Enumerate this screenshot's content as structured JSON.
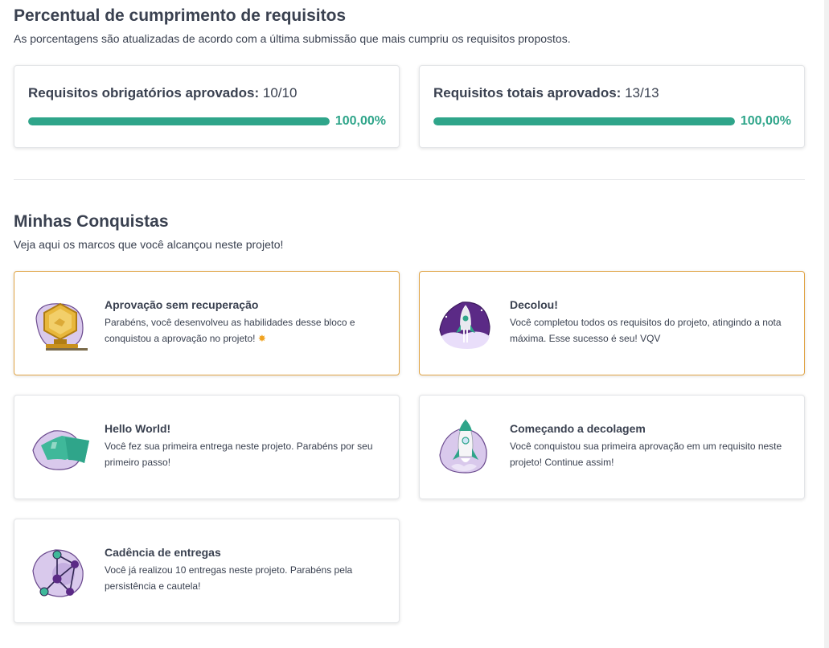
{
  "requirements": {
    "title": "Percentual de cumprimento de requisitos",
    "subtitle": "As porcentagens são atualizadas de acordo com a última submissão que mais cumpriu os requisitos propostos.",
    "cards": [
      {
        "label": "Requisitos obrigatórios aprovados:",
        "value": "10/10",
        "percent_text": "100,00%",
        "progress": 1.0
      },
      {
        "label": "Requisitos totais aprovados:",
        "value": "13/13",
        "percent_text": "100,00%",
        "progress": 1.0
      }
    ]
  },
  "achievements": {
    "title": "Minhas Conquistas",
    "subtitle": "Veja aqui os marcos que você alcançou neste projeto!",
    "items": [
      {
        "title": "Aprovação sem recuperação",
        "description": "Parabéns, você desenvolveu as habilidades desse bloco e conquistou a aprovação no projeto!",
        "icon": "trophy-badge-icon",
        "highlighted": true
      },
      {
        "title": "Decolou!",
        "description": "Você completou todos os requisitos do projeto, atingindo a nota máxima. Esse sucesso é seu! VQV",
        "icon": "rocket-launch-icon",
        "highlighted": true
      },
      {
        "title": "Hello World!",
        "description": "Você fez sua primeira entrega neste projeto. Parabéns por seu primeiro passo!",
        "icon": "flag-icon",
        "highlighted": false
      },
      {
        "title": "Começando a decolagem",
        "description": "Você conquistou sua primeira aprovação em um requisito neste projeto! Continue assim!",
        "icon": "rocket-icon",
        "highlighted": false
      },
      {
        "title": "Cadência de entregas",
        "description": "Você já realizou 10 entregas neste projeto. Parabéns pela persistência e cautela!",
        "icon": "network-nodes-icon",
        "highlighted": false
      }
    ]
  },
  "colors": {
    "accent": "#2fa58a",
    "highlight_border": "#e0a445",
    "text": "#3a4150",
    "badge_purple": "#d9c9ec",
    "badge_dark_purple": "#5b2a86"
  }
}
